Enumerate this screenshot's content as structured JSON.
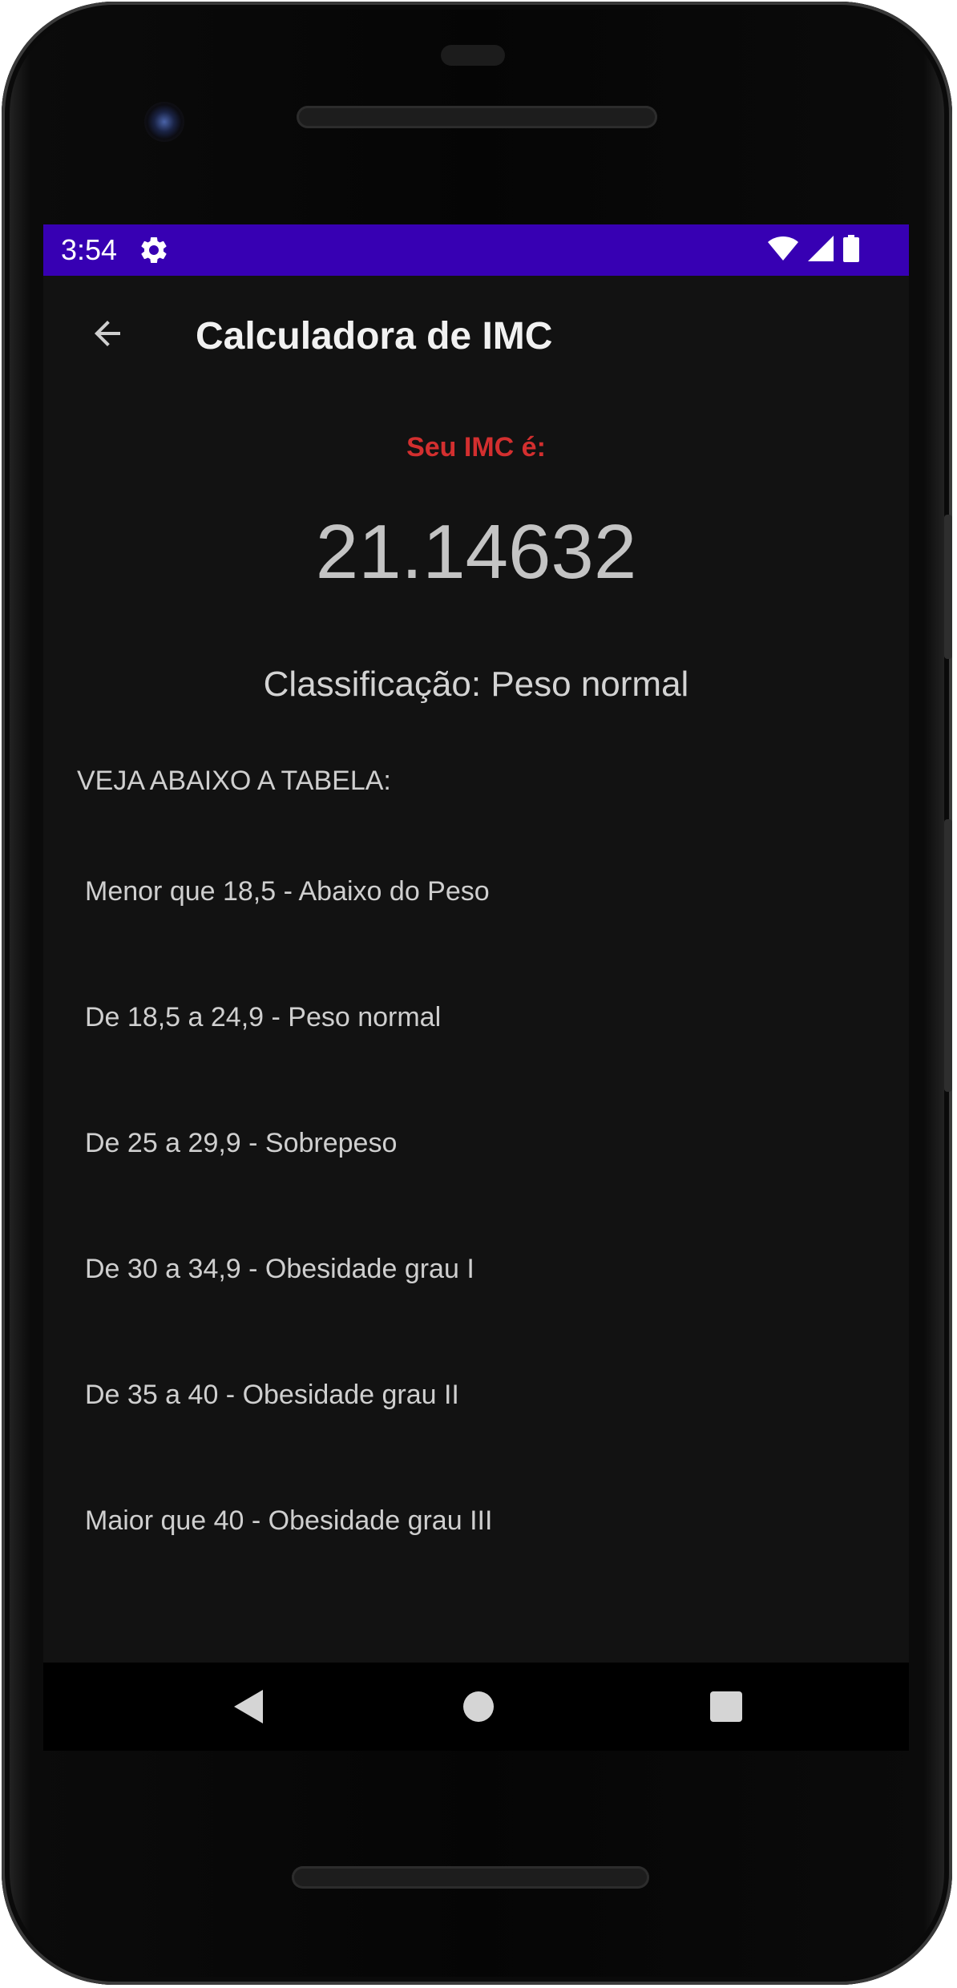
{
  "status_bar": {
    "time": "3:54",
    "background_color": "#3700b3",
    "icons": [
      "gear-icon",
      "wifi-icon",
      "signal-icon",
      "battery-icon"
    ]
  },
  "toolbar": {
    "title": "Calculadora de IMC",
    "back_icon": "arrow-back-icon"
  },
  "result": {
    "label": "Seu IMC é:",
    "label_color": "#d32f2f",
    "value": "21.14632",
    "classification": "Classificação: Peso normal"
  },
  "table": {
    "heading": "VEJA ABAIXO A TABELA:",
    "rows": [
      "Menor que 18,5 - Abaixo do Peso",
      "De 18,5 a 24,9 - Peso normal",
      "De 25 a 29,9 - Sobrepeso",
      "De 30 a 34,9 - Obesidade grau I",
      "De 35 a 40 - Obesidade grau II",
      "Maior que 40 - Obesidade grau III"
    ]
  },
  "nav_bar": {
    "icons": [
      "nav-back-icon",
      "nav-home-icon",
      "nav-recents-icon"
    ]
  }
}
